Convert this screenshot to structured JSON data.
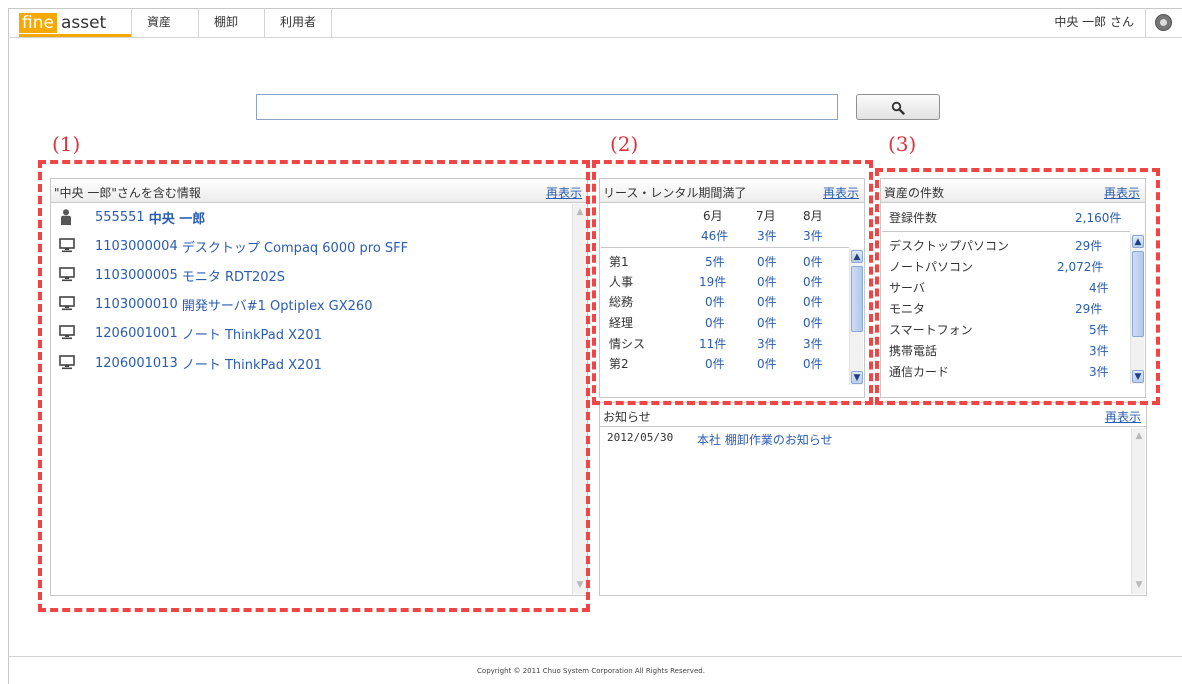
{
  "header": {
    "logo_fine": "fine",
    "logo_asset": "asset",
    "nav": [
      "資産",
      "棚卸",
      "利用者"
    ],
    "user": "中央 一郎 さん",
    "settings_icon": "gear-icon"
  },
  "search": {
    "placeholder": "",
    "value": "",
    "button_icon": "search-icon"
  },
  "markers": [
    "(1)",
    "(2)",
    "(3)"
  ],
  "panel1": {
    "title": "\"中央 一郎\"さんを含む情報",
    "refresh": "再表示",
    "items": [
      {
        "icon": "person-icon",
        "id": "555551",
        "name": "中央 一郎"
      },
      {
        "icon": "monitor-icon",
        "id": "1103000004",
        "name": "デスクトップ Compaq 6000 pro SFF"
      },
      {
        "icon": "monitor-icon",
        "id": "1103000005",
        "name": "モニタ RDT202S"
      },
      {
        "icon": "monitor-icon",
        "id": "1103000010",
        "name": "開発サーバ#1 Optiplex GX260"
      },
      {
        "icon": "monitor-icon",
        "id": "1206001001",
        "name": "ノート ThinkPad X201"
      },
      {
        "icon": "monitor-icon",
        "id": "1206001013",
        "name": "ノート ThinkPad X201"
      }
    ]
  },
  "panel2": {
    "title": "リース・レンタル期間満了",
    "refresh": "再表示",
    "months": [
      "6月",
      "7月",
      "8月"
    ],
    "totals": [
      "46件",
      "3件",
      "3件"
    ],
    "rows": [
      {
        "dept": "第1",
        "v": [
          "5件",
          "0件",
          "0件"
        ]
      },
      {
        "dept": "人事",
        "v": [
          "19件",
          "0件",
          "0件"
        ]
      },
      {
        "dept": "総務",
        "v": [
          "0件",
          "0件",
          "0件"
        ]
      },
      {
        "dept": "経理",
        "v": [
          "0件",
          "0件",
          "0件"
        ]
      },
      {
        "dept": "情シス",
        "v": [
          "11件",
          "3件",
          "3件"
        ]
      },
      {
        "dept": "第2",
        "v": [
          "0件",
          "0件",
          "0件"
        ]
      }
    ]
  },
  "panel3": {
    "title": "資産の件数",
    "refresh": "再表示",
    "total_label": "登録件数",
    "total_value": "2,160件",
    "rows": [
      {
        "label": "デスクトップパソコン",
        "value": "29件"
      },
      {
        "label": "ノートパソコン",
        "value": "2,072件"
      },
      {
        "label": "サーバ",
        "value": "4件"
      },
      {
        "label": "モニタ",
        "value": "29件"
      },
      {
        "label": "スマートフォン",
        "value": "5件"
      },
      {
        "label": "携帯電話",
        "value": "3件"
      },
      {
        "label": "通信カード",
        "value": "3件"
      }
    ]
  },
  "notice": {
    "title": "お知らせ",
    "refresh": "再表示",
    "items": [
      {
        "date": "2012/05/30",
        "text": "本社 棚卸作業のお知らせ"
      }
    ]
  },
  "footer": "Copyright © 2011 Chuo System Corporation All Rights Reserved."
}
